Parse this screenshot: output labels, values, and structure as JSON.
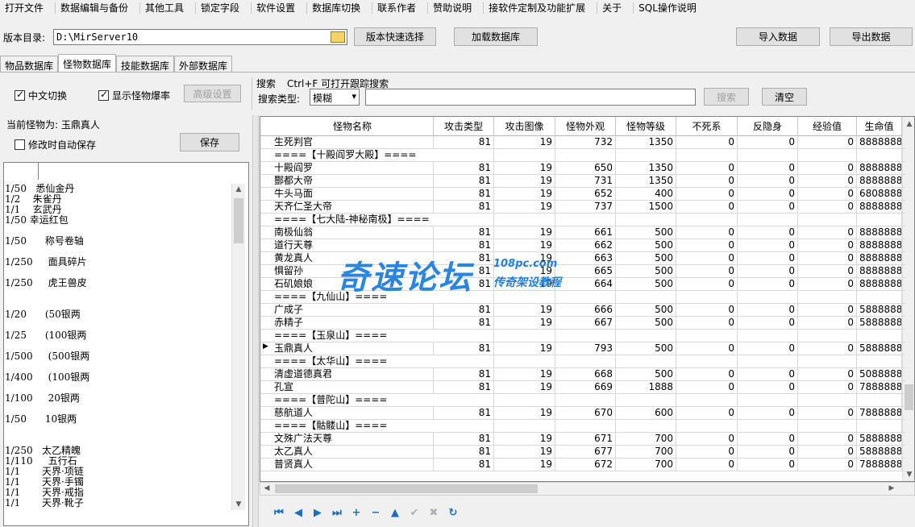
{
  "menu": [
    "打开文件",
    "数据编辑与备份",
    "其他工具",
    "锁定字段",
    "软件设置",
    "数据库切换",
    "联系作者",
    "赞助说明",
    "接软件定制及功能扩展",
    "关于",
    "SQL操作说明"
  ],
  "path": {
    "label": "版本目录:",
    "value": "D:\\MirServer10",
    "quick_select": "版本快速选择",
    "load_db": "加载数据库",
    "import": "导入数据",
    "export": "导出数据"
  },
  "tabs": [
    {
      "label": "物品数据库",
      "active": false
    },
    {
      "label": "怪物数据库",
      "active": true
    },
    {
      "label": "技能数据库",
      "active": false
    },
    {
      "label": "外部数据库",
      "active": false
    }
  ],
  "options": {
    "chinese_switch": "中文切换",
    "chinese_switch_checked": true,
    "show_drop_rate": "显示怪物爆率",
    "show_drop_rate_checked": true,
    "advanced": "高级设置",
    "current_monster": "当前怪物为: 玉鼎真人",
    "autosave": "修改时自动保存",
    "autosave_checked": false,
    "save": "保存"
  },
  "search": {
    "title": "搜索",
    "hint": "Ctrl+F 可打开跟踪搜索",
    "type_label": "搜索类型:",
    "type_value": "模糊",
    "button": "搜索",
    "clear": "清空"
  },
  "drops": [
    "1/50   悉仙金丹",
    "1/2    朱雀丹",
    "1/1    玄武丹",
    "1/50 幸运红包",
    "",
    "1/50      称号卷轴",
    "",
    "1/250     面具碎片",
    "",
    "1/250     虎王兽皮",
    "",
    "",
    "1/20      (50银两",
    "",
    "1/25      (100银两",
    "",
    "1/500     (500银两",
    "",
    "1/400     (100银两",
    "",
    "1/100     20银两",
    "",
    "1/50      10银两",
    "",
    "",
    "1/250   太乙精魄",
    "1/110     五行石",
    "1/1       天界·项链",
    "1/1       天界·手镯",
    "1/1       天界·戒指",
    "1/1       天界·靴子"
  ],
  "grid": {
    "headers": [
      "怪物名称",
      "攻击类型",
      "攻击图像",
      "怪物外观",
      "怪物等级",
      "不死系",
      "反隐身",
      "经验值",
      "生命值"
    ],
    "rows": [
      [
        "生死判官",
        "81",
        "19",
        "732",
        "1350",
        "0",
        "0",
        "0",
        "8888888"
      ],
      [
        "====【十殿阎罗大殿】====",
        "",
        "",
        "",
        "",
        "",
        "",
        "",
        ""
      ],
      [
        "十殿阎罗",
        "81",
        "19",
        "650",
        "1350",
        "0",
        "0",
        "0",
        "8888888"
      ],
      [
        "酆都大帝",
        "81",
        "19",
        "731",
        "1350",
        "0",
        "0",
        "0",
        "8888888"
      ],
      [
        "牛头马面",
        "81",
        "19",
        "652",
        "400",
        "0",
        "0",
        "0",
        "6808888"
      ],
      [
        "天齐仁圣大帝",
        "81",
        "19",
        "737",
        "1500",
        "0",
        "0",
        "0",
        "8888888"
      ],
      [
        "====【七大陆-神秘南极】====",
        "",
        "",
        "",
        "",
        "",
        "",
        "",
        ""
      ],
      [
        "南极仙翁",
        "81",
        "19",
        "661",
        "500",
        "0",
        "0",
        "0",
        "8888888"
      ],
      [
        "道行天尊",
        "81",
        "19",
        "662",
        "500",
        "0",
        "0",
        "0",
        "8888888"
      ],
      [
        "黄龙真人",
        "81",
        "19",
        "663",
        "500",
        "0",
        "0",
        "0",
        "8888888"
      ],
      [
        "惧留孙",
        "81",
        "19",
        "665",
        "500",
        "0",
        "0",
        "0",
        "8888888"
      ],
      [
        "石矶娘娘",
        "81",
        "19",
        "664",
        "500",
        "0",
        "0",
        "0",
        "8888888"
      ],
      [
        "====【九仙山】====",
        "",
        "",
        "",
        "",
        "",
        "",
        "",
        ""
      ],
      [
        "广成子",
        "81",
        "19",
        "666",
        "500",
        "0",
        "0",
        "0",
        "5888888"
      ],
      [
        "赤精子",
        "81",
        "19",
        "667",
        "500",
        "0",
        "0",
        "0",
        "5888888"
      ],
      [
        "====【玉泉山】====",
        "",
        "",
        "",
        "",
        "",
        "",
        "",
        ""
      ],
      [
        "玉鼎真人",
        "81",
        "19",
        "793",
        "500",
        "0",
        "0",
        "0",
        "5888888"
      ],
      [
        "====【太华山】====",
        "",
        "",
        "",
        "",
        "",
        "",
        "",
        ""
      ],
      [
        "清虚道德真君",
        "81",
        "19",
        "668",
        "500",
        "0",
        "0",
        "0",
        "5088888"
      ],
      [
        "孔宣",
        "81",
        "19",
        "669",
        "1888",
        "0",
        "0",
        "0",
        "7888888"
      ],
      [
        "====【普陀山】====",
        "",
        "",
        "",
        "",
        "",
        "",
        "",
        ""
      ],
      [
        "慈航道人",
        "81",
        "19",
        "670",
        "600",
        "0",
        "0",
        "0",
        "7888888"
      ],
      [
        "====【骷髅山】====",
        "",
        "",
        "",
        "",
        "",
        "",
        "",
        ""
      ],
      [
        "文殊广法天尊",
        "81",
        "19",
        "671",
        "700",
        "0",
        "0",
        "0",
        "5888888"
      ],
      [
        "太乙真人",
        "81",
        "19",
        "677",
        "700",
        "0",
        "0",
        "0",
        "5888888"
      ],
      [
        "普贤真人",
        "81",
        "19",
        "672",
        "700",
        "0",
        "0",
        "0",
        "7888888"
      ]
    ],
    "selected_row": 16
  },
  "nav_icons": [
    "first-icon",
    "prior-icon",
    "next-icon",
    "last-icon",
    "insert-icon",
    "delete-icon",
    "edit-icon",
    "post-icon",
    "cancel-icon",
    "refresh-icon"
  ],
  "watermark": {
    "main": "奇速论坛",
    "url": "108pc.com",
    "sub": "传奇架设教程"
  }
}
